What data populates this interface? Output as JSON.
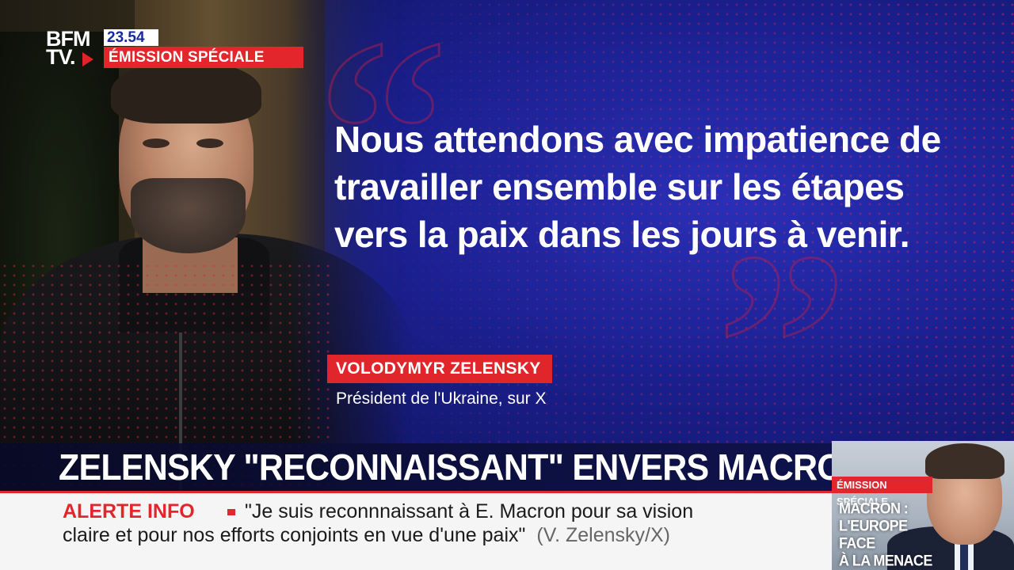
{
  "channel": {
    "logo_line1": "BFM",
    "logo_line2": "TV.",
    "clock": "23.54",
    "program_label": "ÉMISSION SPÉCIALE"
  },
  "quote": {
    "text": "Nous attendons avec impatience de travailler ensemble sur les étapes vers la paix dans les jours à venir.",
    "speaker": "VOLODYMYR ZELENSKY",
    "speaker_title": "Président de l'Ukraine, sur X"
  },
  "headline": {
    "text": "ZELENSKY \"RECONNAISSANT\" ENVERS MACRON"
  },
  "ticker": {
    "label": "ALERTE INFO",
    "line1": "\"Je suis reconnnaissant à E. Macron pour sa vision",
    "line2": "claire et pour nos efforts conjoints en vue d'une paix\"",
    "source": "(V. Zelensky/X)"
  },
  "promo": {
    "label": "ÉMISSION SPÉCIALE",
    "title_line1": "MACRON :",
    "title_line2": "L'EUROPE FACE",
    "title_line3": "À LA MENACE"
  },
  "colors": {
    "accent_red": "#e3262b",
    "background_blue": "#1a1f8e",
    "ticker_bg": "#f5f5f5"
  }
}
